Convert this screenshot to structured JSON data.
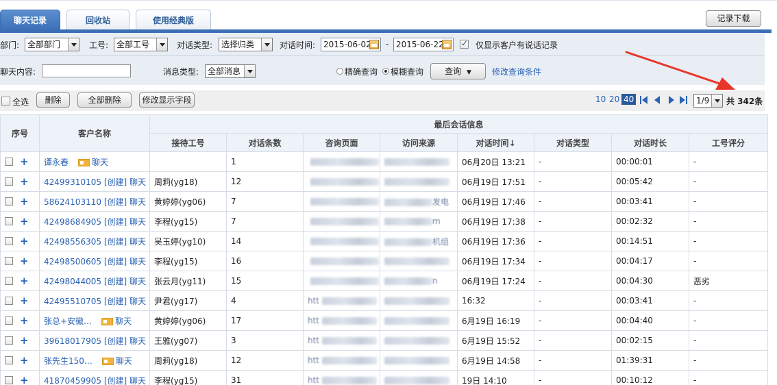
{
  "tabs": [
    {
      "label": "聊天记录",
      "active": true
    },
    {
      "label": "回收站",
      "active": false
    },
    {
      "label": "使用经典版",
      "active": false
    }
  ],
  "download_button": "记录下载",
  "filters": {
    "dept_label": "部门:",
    "dept_value": "全部部门",
    "staff_label": "工号:",
    "staff_value": "全部工号",
    "type_label": "对话类型:",
    "type_value": "选择归类",
    "time_label": "对话时间:",
    "date_from": "2015-06-02",
    "date_sep": "-",
    "date_to": "2015-06-22",
    "only_customer_label": "仅显示客户有说话记录",
    "content_label": "聊天内容:",
    "content_value": "",
    "msgtype_label": "消息类型:",
    "msgtype_value": "全部消息",
    "exact_label": "精确查询",
    "fuzzy_label": "模糊查询",
    "query_button": "查询",
    "modify_link": "修改查询条件"
  },
  "toolbar": {
    "select_all": "全选",
    "delete": "删除",
    "delete_all": "全部删除",
    "modify_fields": "修改显示字段",
    "page_sizes": [
      "10",
      "20",
      "40"
    ],
    "current_page_size": "40",
    "page_select": "1/9",
    "total": "共 342条"
  },
  "table": {
    "group_header": "最后会话信息",
    "headers": {
      "index": "序号",
      "customer": "客户名称",
      "staff": "接待工号",
      "count": "对话条数",
      "page": "咨询页面",
      "source": "访问来源",
      "time": "对话时间↓",
      "type": "对话类型",
      "duration": "对话时长",
      "rating": "工号评分"
    },
    "rows": [
      {
        "customer": "谭永春",
        "created": "",
        "card": true,
        "chat": "聊天",
        "staff": "",
        "count": "1",
        "time": "06月20日  13:21",
        "type": "-",
        "duration": "00:00:01",
        "rating": "-"
      },
      {
        "customer": "42499310105",
        "created": "[创建]",
        "card": false,
        "chat": "聊天",
        "staff": "周莉(yg18)",
        "count": "12",
        "time": "06月19日  17:51",
        "type": "-",
        "duration": "00:05:42",
        "rating": "-"
      },
      {
        "customer": "58624103110",
        "created": "[创建]",
        "card": false,
        "chat": "聊天",
        "staff": "黄婷婷(yg06)",
        "count": "7",
        "time": "06月19日  17:46",
        "type": "-",
        "duration": "00:03:41",
        "rating": "-"
      },
      {
        "customer": "42498684905",
        "created": "[创建]",
        "card": false,
        "chat": "聊天",
        "staff": "李程(yg15)",
        "count": "7",
        "time": "06月19日  17:38",
        "type": "-",
        "duration": "00:02:32",
        "rating": "-"
      },
      {
        "customer": "42498556305",
        "created": "[创建]",
        "card": false,
        "chat": "聊天",
        "staff": "吴玉婷(yg10)",
        "count": "14",
        "time": "06月19日  17:36",
        "type": "-",
        "duration": "00:14:51",
        "rating": "-"
      },
      {
        "customer": "42498500605",
        "created": "[创建]",
        "card": false,
        "chat": "聊天",
        "staff": "李程(yg15)",
        "count": "16",
        "time": "06月19日  17:34",
        "type": "-",
        "duration": "00:04:17",
        "rating": "-"
      },
      {
        "customer": "42498044005",
        "created": "[创建]",
        "card": false,
        "chat": "聊天",
        "staff": "张云月(yg11)",
        "count": "15",
        "time": "06月19日  17:24",
        "type": "-",
        "duration": "00:04:30",
        "rating": "恶劣"
      },
      {
        "customer": "42495510705",
        "created": "[创建]",
        "card": false,
        "chat": "聊天",
        "staff": "尹君(yg17)",
        "count": "4",
        "time": "16:32",
        "type": "-",
        "duration": "00:03:41",
        "rating": "-"
      },
      {
        "customer": "张总+安徽…",
        "created": "",
        "card": true,
        "chat": "聊天",
        "staff": "黄婷婷(yg06)",
        "count": "17",
        "time": "6月19日  16:19",
        "type": "-",
        "duration": "00:04:40",
        "rating": "-"
      },
      {
        "customer": "39618017905",
        "created": "[创建]",
        "card": false,
        "chat": "聊天",
        "staff": "王雅(yg07)",
        "count": "3",
        "time": "6月19日  15:52",
        "type": "-",
        "duration": "00:02:15",
        "rating": "-"
      },
      {
        "customer": "张先生150…",
        "created": "",
        "card": true,
        "chat": "聊天",
        "staff": "周莉(yg18)",
        "count": "12",
        "time": "6月19日  14:58",
        "type": "-",
        "duration": "01:39:31",
        "rating": "-"
      },
      {
        "customer": "41870459905",
        "created": "[创建]",
        "card": false,
        "chat": "聊天",
        "staff": "李程(yg15)",
        "count": "31",
        "time": "19日  14:10",
        "type": "-",
        "duration": "00:10:12",
        "rating": "-"
      }
    ],
    "page_fragments": [
      "",
      "",
      "",
      "",
      "",
      "",
      "",
      "htt",
      "htt",
      "htt",
      "htt",
      "htt"
    ],
    "source_fragments": [
      "",
      "",
      "发电",
      "m",
      "机组",
      "",
      "n",
      "",
      "",
      "",
      "",
      ""
    ]
  },
  "colors": {
    "tab_active": "#3a6fb6",
    "link": "#2a62b4",
    "filter_bg": "#e9eef5",
    "arrow": "#e8372a"
  }
}
